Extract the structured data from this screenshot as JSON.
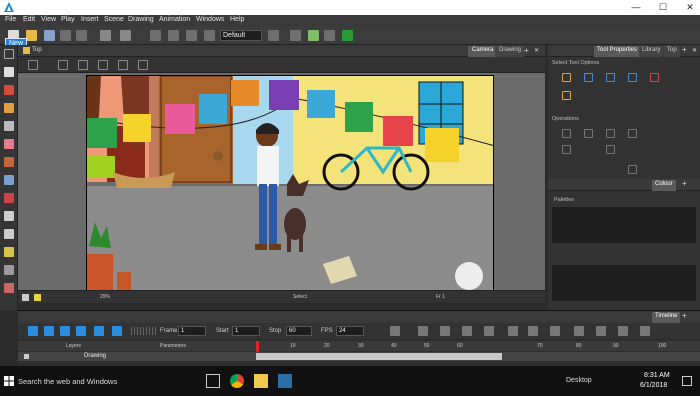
{
  "app": {
    "title": "",
    "accent": "#2a7fd4"
  },
  "window_controls": {
    "minimize": "—",
    "maximize": "☐",
    "close": "✕"
  },
  "menu": [
    "File",
    "Edit",
    "View",
    "Play",
    "Insert",
    "Scene",
    "Drawing",
    "Animation",
    "Windows",
    "Help"
  ],
  "tooltip": "New",
  "toolbar": {
    "preset_value": "Default"
  },
  "view": {
    "title": "Top",
    "tabs": [
      "Camera",
      "Drawing"
    ],
    "active_tab": "Camera",
    "status_zoom": "29%",
    "status_tool": "Select",
    "status_frame": "Fr 1"
  },
  "right_panel": {
    "tabs": [
      "Tool Properties",
      "Library",
      "Top"
    ],
    "active_tab": "Tool Properties",
    "select_tool_options": "Select Tool Options",
    "operations": "Operations",
    "colour_tab": "Colour",
    "palettes_label": "Palettes"
  },
  "timeline": {
    "tab": "Timeline",
    "frame_label": "Frame",
    "frame_value": "1",
    "start_label": "Start",
    "start_value": "1",
    "stop_label": "Stop",
    "stop_value": "60",
    "fps_label": "FPS",
    "fps_value": "24",
    "layers_header": "Layers",
    "parameters_header": "Parameters",
    "ruler": [
      "10",
      "20",
      "30",
      "40",
      "50",
      "60",
      "70",
      "80",
      "90",
      "100"
    ],
    "layer_name": "Drawing"
  },
  "taskbar": {
    "search_placeholder": "Search the web and Windows",
    "desktop_label": "Desktop",
    "time": "8:31 AM",
    "date": "6/1/2018"
  },
  "icons": {
    "new": "new-document-icon",
    "open": "open-folder-icon",
    "save": "save-icon",
    "undo": "undo-icon",
    "redo": "redo-icon",
    "select": "arrow-select-icon",
    "brush": "brush-icon",
    "pencil": "pencil-icon",
    "text": "text-tool-icon",
    "eraser": "eraser-icon",
    "paint": "paint-bucket-icon",
    "eyedropper": "eyedropper-icon",
    "hand": "hand-icon",
    "zoom": "zoom-icon",
    "play": "play-icon",
    "stop": "stop-icon",
    "loop": "loop-icon",
    "sound": "sound-icon",
    "search": "search-icon",
    "windows": "windows-logo-icon"
  }
}
